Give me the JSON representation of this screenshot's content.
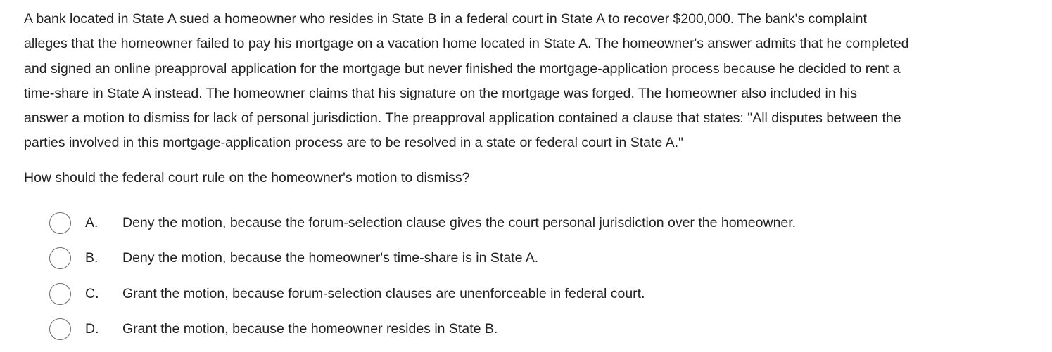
{
  "question": {
    "passage_lines": [
      "A bank located in State A sued a homeowner who resides in State B in a federal court in State A to recover $200,000.  The bank's complaint",
      "alleges that the homeowner failed to pay his mortgage on a vacation home located in State A.  The homeowner's answer admits that he completed",
      "and signed an online preapproval application for the mortgage but never finished the mortgage-application process because he decided to rent a",
      "time-share in State A instead.  The homeowner claims that his signature on the mortgage was forged.  The homeowner also included in his",
      "answer a motion to dismiss for lack of personal jurisdiction.  The preapproval application contained a clause that states: \"All disputes between the",
      "parties involved in this mortgage-application process are to be resolved in a state or federal court in State A.\""
    ],
    "prompt": "How should the federal court rule on the homeowner's motion to dismiss?"
  },
  "options": [
    {
      "letter": "A.",
      "text": "Deny the motion, because the forum-selection clause gives the court personal jurisdiction over the homeowner.",
      "selected": false
    },
    {
      "letter": "B.",
      "text": "Deny the motion, because the homeowner's time-share is in State A.",
      "selected": false
    },
    {
      "letter": "C.",
      "text": "Grant the motion, because forum-selection clauses are unenforceable in federal court.",
      "selected": false
    },
    {
      "letter": "D.",
      "text": "Grant the motion, because the homeowner resides in State B.",
      "selected": false
    }
  ]
}
